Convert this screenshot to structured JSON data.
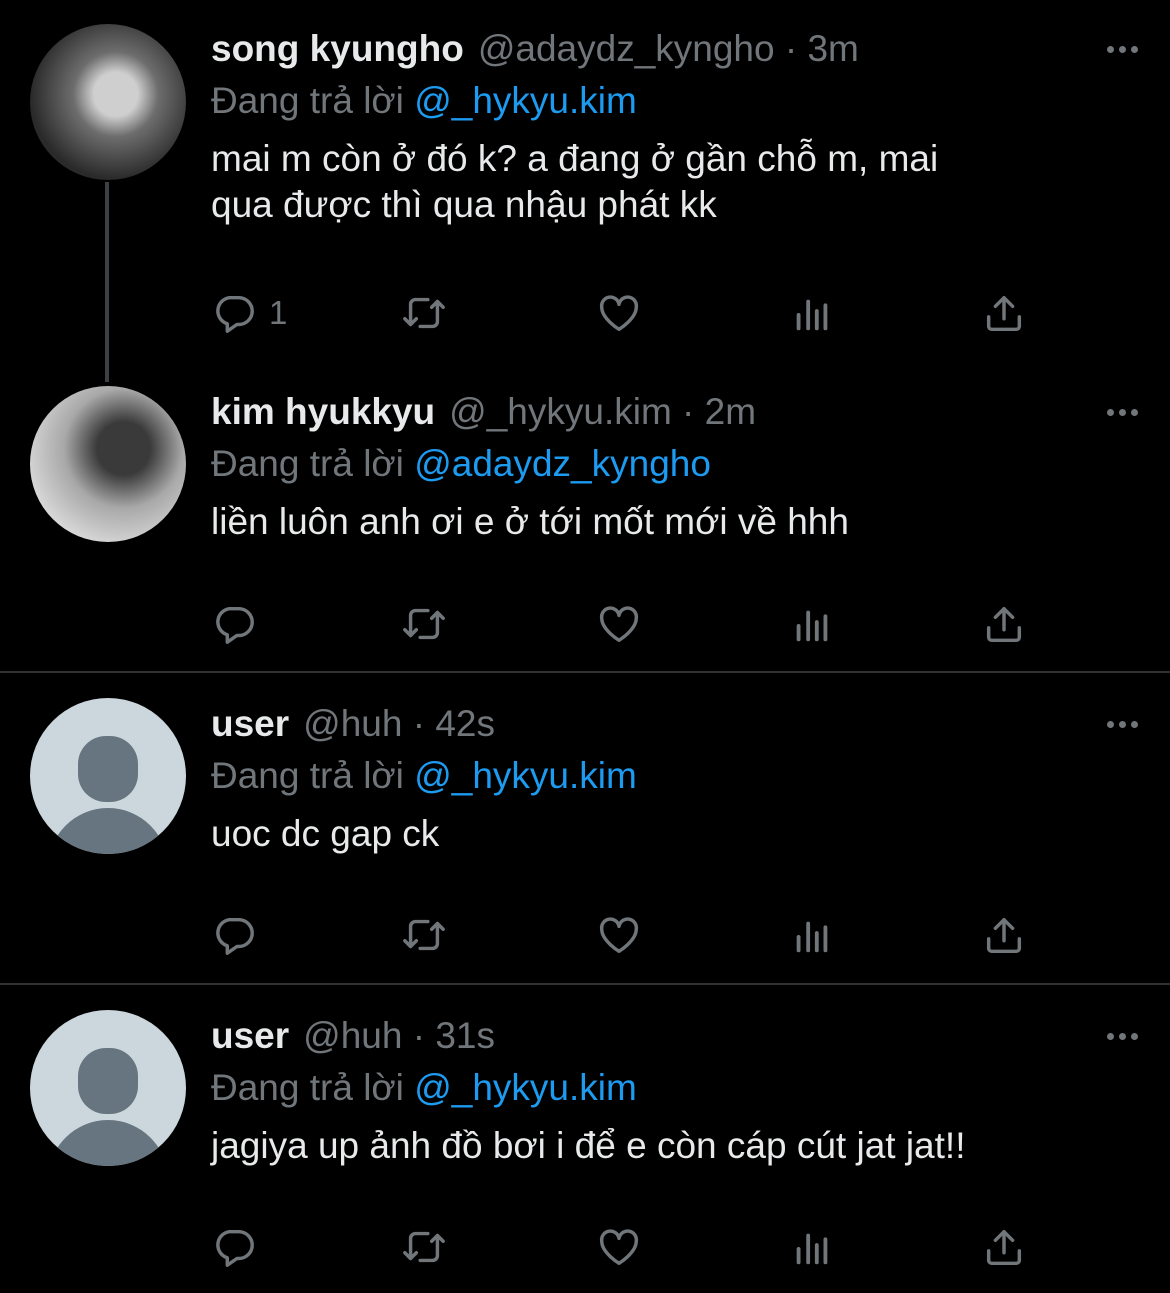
{
  "tweets": [
    {
      "name": "song kyungho",
      "handle": "@adaydz_kyngho",
      "time": "3m",
      "reply_prefix": "Đang trả lời",
      "reply_to": "@_hykyu.kim",
      "text_lines": [
        "mai m còn ở đó k? a đang ở gần chỗ m, mai",
        "qua được thì qua nhậu phát kk"
      ],
      "reply_count": "1"
    },
    {
      "name": "kim hyukkyu",
      "handle": "@_hykyu.kim",
      "time": "2m",
      "reply_prefix": "Đang trả lời",
      "reply_to": "@adaydz_kyngho",
      "text_lines": [
        "liền luôn anh ơi e ở tới mốt mới về hhh"
      ],
      "reply_count": ""
    },
    {
      "name": "user",
      "handle": "@huh",
      "time": "42s",
      "reply_prefix": "Đang trả lời",
      "reply_to": "@_hykyu.kim",
      "text_lines": [
        "uoc dc gap ck"
      ],
      "reply_count": ""
    },
    {
      "name": "user",
      "handle": "@huh",
      "time": "31s",
      "reply_prefix": "Đang trả lời",
      "reply_to": "@_hykyu.kim",
      "text_lines": [
        "jagiya up ảnh đồ bơi i để e còn cáp cút jat jat!!"
      ],
      "reply_count": ""
    }
  ],
  "colors": {
    "background": "#000000",
    "text": "#e7e9ea",
    "muted": "#71767b",
    "link": "#1d9bf0"
  },
  "icons": [
    "reply-icon",
    "retweet-icon",
    "like-icon",
    "views-icon",
    "share-icon",
    "more-icon"
  ]
}
